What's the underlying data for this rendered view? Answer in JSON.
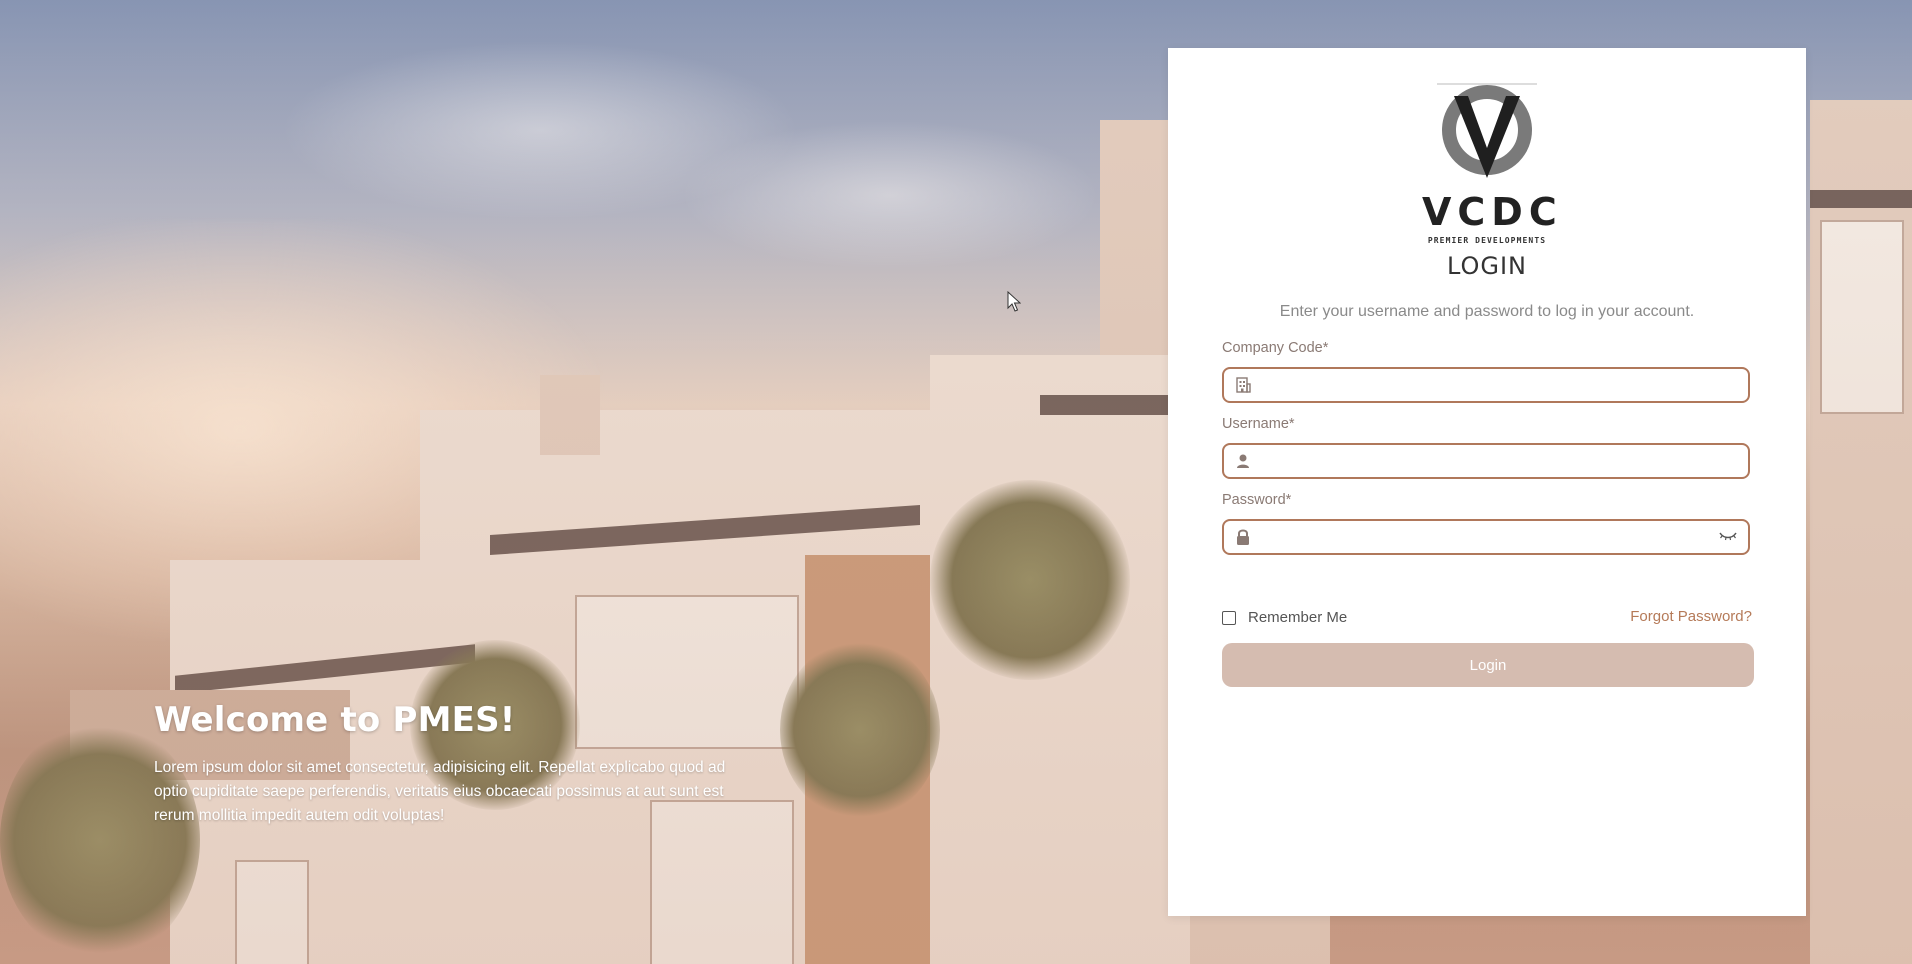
{
  "welcome": {
    "title": "Welcome to PMES!",
    "body": "Lorem ipsum dolor sit amet consectetur, adipisicing elit. Repellat explicabo quod ad optio cupiditate saepe perferendis, veritatis eius obcaecati possimus at aut sunt est rerum mollitia impedit autem odit voluptas!"
  },
  "logo": {
    "name": "VCDC",
    "tagline": "PREMIER DEVELOPMENTS"
  },
  "login": {
    "title": "LOGIN",
    "subtitle": "Enter your username and password to log in your account.",
    "company_code_label": "Company Code*",
    "company_code_value": "",
    "username_label": "Username*",
    "username_value": "",
    "password_label": "Password*",
    "password_value": "",
    "remember_label": "Remember Me",
    "remember_checked": false,
    "forgot_label": "Forgot Password?",
    "button_label": "Login"
  },
  "colors": {
    "accent": "#b0785b",
    "button_bg": "#d5bcb0",
    "link": "#b57a58"
  },
  "icons": {
    "company_code": "building-icon",
    "username": "user-icon",
    "password": "lock-icon",
    "toggle_password": "eye-closed-icon"
  }
}
